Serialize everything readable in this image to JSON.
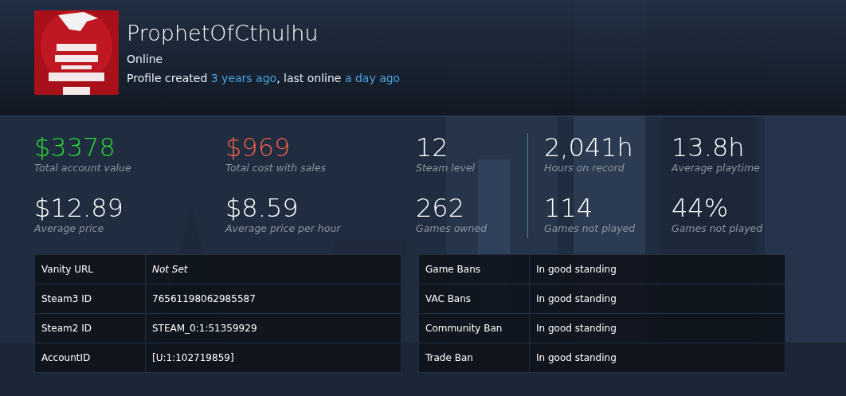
{
  "profile": {
    "name": "ProphetOfCthulhu",
    "status": "Online",
    "history": {
      "created_prefix": "Profile created",
      "created_link": "3 years ago",
      "online_prefix": ", last online",
      "online_link": "a day ago"
    }
  },
  "stats": [
    {
      "value": "$3378",
      "label": "Total account value",
      "kind": "gain"
    },
    {
      "value": "$969",
      "label": "Total cost with sales",
      "kind": "cost"
    },
    {
      "value": "12",
      "label": "Steam level",
      "kind": "plain"
    },
    {
      "value": "2,041h",
      "label": "Hours on record",
      "kind": "plain"
    },
    {
      "value": "13.8h",
      "label": "Average playtime",
      "kind": "plain"
    },
    {
      "value": "$12.89",
      "label": "Average price",
      "kind": "plain"
    },
    {
      "value": "$8.59",
      "label": "Average price per hour",
      "kind": "plain"
    },
    {
      "value": "262",
      "label": "Games owned",
      "kind": "plain"
    },
    {
      "value": "114",
      "label": "Games not played",
      "kind": "plain"
    },
    {
      "value": "44%",
      "label": "Games not played",
      "kind": "plain"
    }
  ],
  "id_table": [
    {
      "label": "Vanity URL",
      "value": "Not Set",
      "kind": "unset"
    },
    {
      "label": "Steam3 ID",
      "value": "76561198062985587",
      "kind": "value"
    },
    {
      "label": "Steam2 ID",
      "value": "STEAM_0:1:51359929",
      "kind": "value"
    },
    {
      "label": "AccountID",
      "value": "[U:1:102719859]",
      "kind": "value"
    }
  ],
  "ban_table": [
    {
      "label": "Game Bans",
      "value": "In good standing"
    },
    {
      "label": "VAC Bans",
      "value": "In good standing"
    },
    {
      "label": "Community Ban",
      "value": "In good standing"
    },
    {
      "label": "Trade Ban",
      "value": "In good standing"
    }
  ]
}
